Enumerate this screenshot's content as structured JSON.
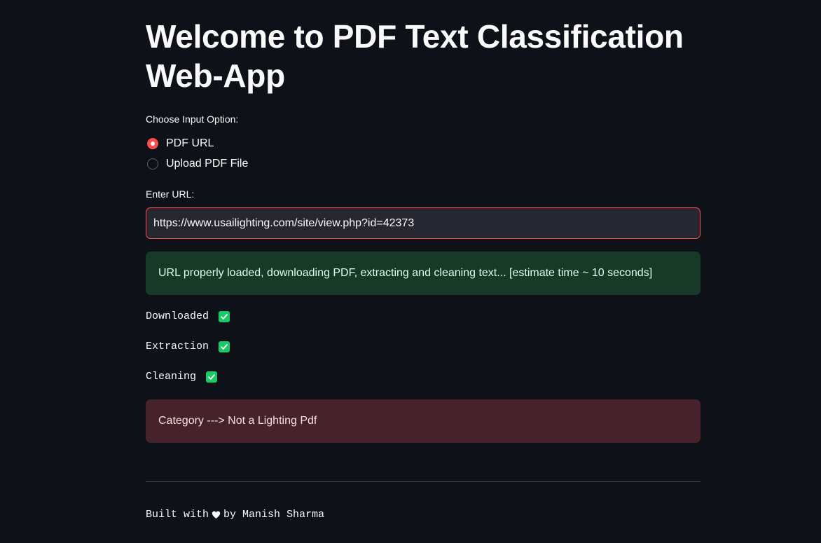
{
  "page": {
    "title": "Welcome to PDF Text Classification Web-App"
  },
  "input_option": {
    "label": "Choose Input Option:",
    "options": [
      {
        "label": "PDF URL",
        "selected": true
      },
      {
        "label": "Upload PDF File",
        "selected": false
      }
    ]
  },
  "url_field": {
    "label": "Enter URL:",
    "value": "https://www.usailighting.com/site/view.php?id=42373"
  },
  "success_message": "URL properly loaded, downloading PDF, extracting and cleaning text... [estimate time ~ 10 seconds]",
  "steps": [
    {
      "label": "Downloaded",
      "done": true,
      "icon": "check-icon"
    },
    {
      "label": "Extraction",
      "done": true,
      "icon": "check-icon"
    },
    {
      "label": "Cleaning",
      "done": true,
      "icon": "check-icon"
    }
  ],
  "result_message": "Category ---> Not a Lighting Pdf",
  "footer": {
    "prefix": "Built with",
    "icon": "heart-icon",
    "suffix": "by Manish Sharma"
  },
  "colors": {
    "background": "#0e1117",
    "accent": "#ff4b4b",
    "success_bg": "#173928",
    "error_bg": "#46232a",
    "check": "#18c964"
  }
}
